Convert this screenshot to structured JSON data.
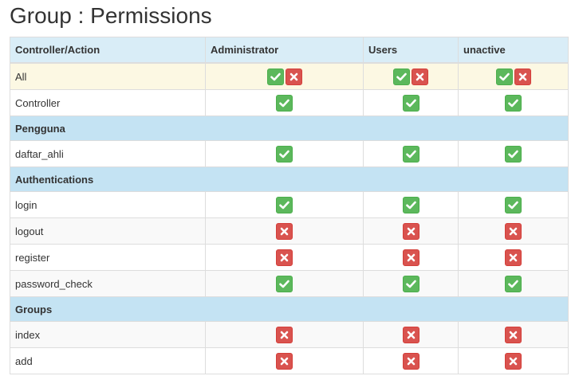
{
  "page": {
    "title": "Group : Permissions"
  },
  "table": {
    "headers": [
      "Controller/Action",
      "Administrator",
      "Users",
      "unactive"
    ],
    "rows": [
      {
        "type": "all",
        "label": "All",
        "cells": [
          "both",
          "both",
          "both"
        ]
      },
      {
        "type": "row",
        "label": "Controller",
        "cells": [
          "allow",
          "allow",
          "allow"
        ]
      },
      {
        "type": "section",
        "label": "Pengguna"
      },
      {
        "type": "row",
        "label": "daftar_ahli",
        "cells": [
          "allow",
          "allow",
          "allow"
        ]
      },
      {
        "type": "section",
        "label": "Authentications"
      },
      {
        "type": "row",
        "label": "login",
        "cells": [
          "allow",
          "allow",
          "allow"
        ]
      },
      {
        "type": "row",
        "label": "logout",
        "cells": [
          "deny",
          "deny",
          "deny"
        ]
      },
      {
        "type": "row",
        "label": "register",
        "cells": [
          "deny",
          "deny",
          "deny"
        ]
      },
      {
        "type": "row",
        "label": "password_check",
        "cells": [
          "allow",
          "allow",
          "allow"
        ]
      },
      {
        "type": "section",
        "label": "Groups"
      },
      {
        "type": "row",
        "label": "index",
        "cells": [
          "deny",
          "deny",
          "deny"
        ]
      },
      {
        "type": "row",
        "label": "add",
        "cells": [
          "deny",
          "deny",
          "deny"
        ]
      }
    ]
  },
  "icons": {
    "allow": "check-icon",
    "deny": "times-icon"
  },
  "colors": {
    "allow": "#5cb85c",
    "deny": "#d9534f",
    "header_bg": "#d9edf7",
    "section_bg": "#c4e3f3",
    "all_row_bg": "#fcf8e3"
  }
}
